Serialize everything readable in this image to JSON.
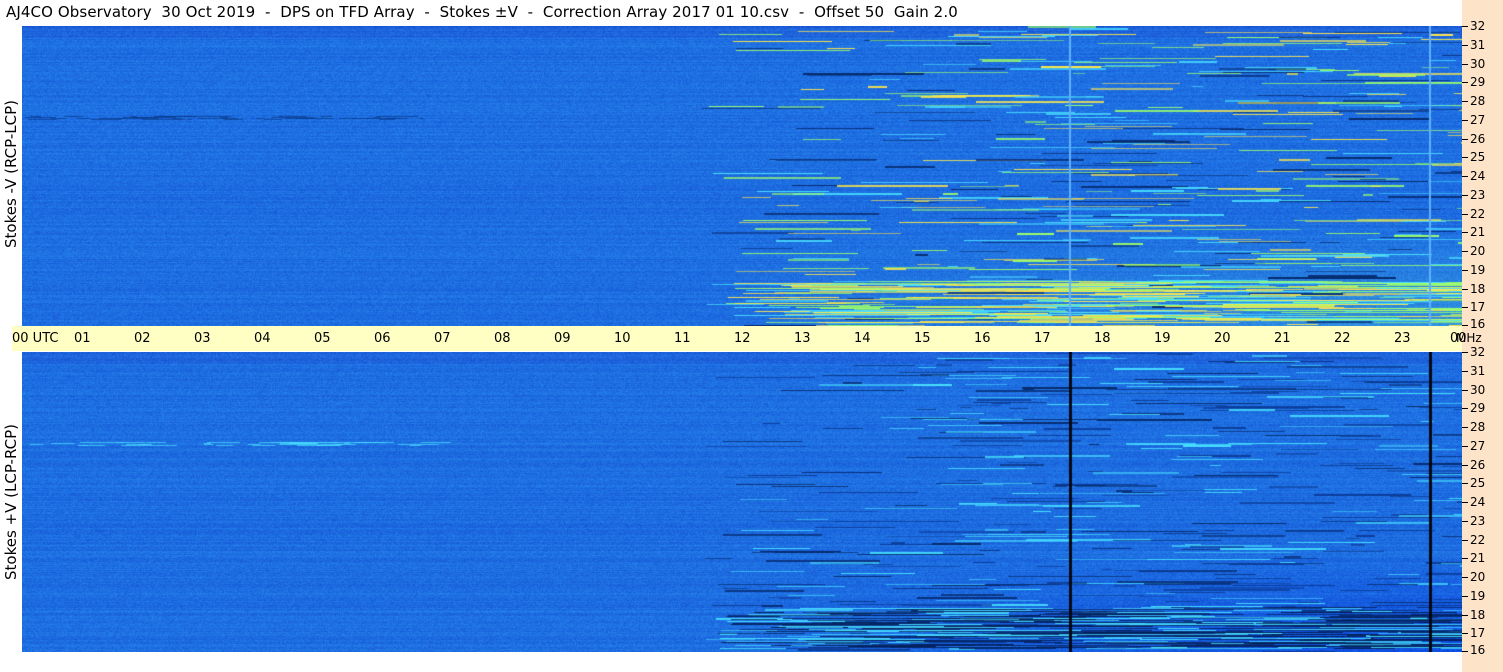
{
  "header": {
    "title": "AJ4CO Observatory  30 Oct 2019  -  DPS on TFD Array  -  Stokes ±V  -  Correction Array 2017 01 10.csv  -  Offset 50  Gain 2.0"
  },
  "panels": {
    "top_label": "Stokes -V (RCP-LCP)",
    "bottom_label": "Stokes +V (LCP-RCP)"
  },
  "utc_axis": {
    "labels": [
      "00 UTC",
      "01",
      "02",
      "03",
      "04",
      "05",
      "06",
      "07",
      "08",
      "09",
      "10",
      "11",
      "12",
      "13",
      "14",
      "15",
      "16",
      "17",
      "18",
      "19",
      "20",
      "21",
      "22",
      "23",
      "00"
    ],
    "unit": "MHz"
  },
  "frequency_axis": {
    "labels": [
      "32",
      "31",
      "30",
      "29",
      "28",
      "27",
      "26",
      "25",
      "24",
      "23",
      "22",
      "21",
      "20",
      "19",
      "18",
      "17",
      "16"
    ]
  },
  "colors": {
    "background_blue": "#1f6ee0",
    "utc_bar": "#ffffc4",
    "freq_strip": "#fde3c8",
    "activity_cyan": "#47e0ff",
    "activity_green": "#9cff6a",
    "activity_yellow": "#ffe84a",
    "activity_dark": "#062a6e"
  }
}
